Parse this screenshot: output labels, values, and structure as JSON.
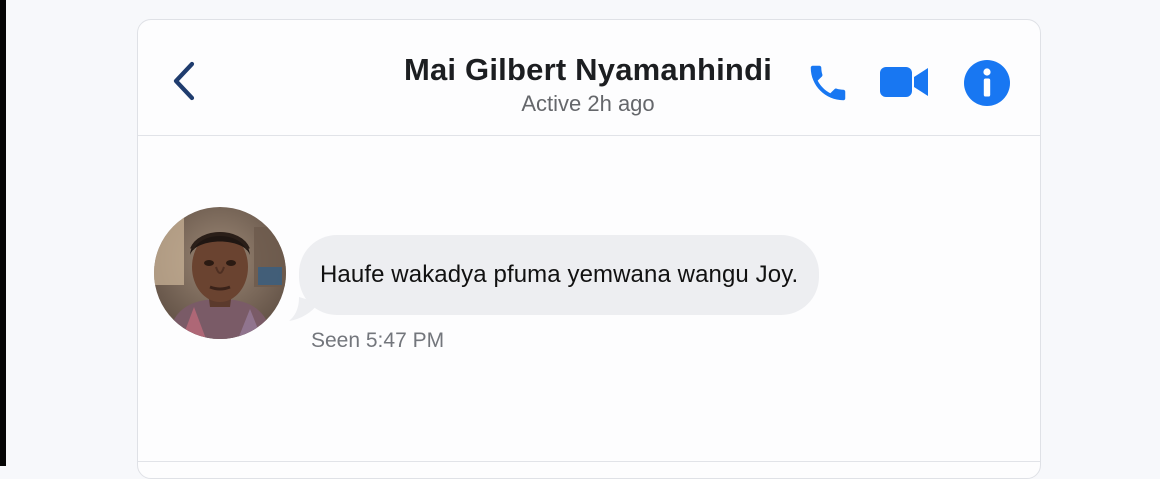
{
  "header": {
    "back_icon": "chevron-left-icon",
    "contact_name": "Mai Gilbert Nyamanhindi",
    "status": "Active 2h ago",
    "call_icon": "phone-icon",
    "video_icon": "video-camera-icon",
    "info_icon": "info-icon"
  },
  "message": {
    "avatar_icon": "contact-avatar",
    "text": "Haufe wakadya pfuma yemwana wangu Joy.",
    "seen": "Seen 5:47 PM"
  },
  "colors": {
    "accent": "#1877f2",
    "back_chevron": "#1f3c6e",
    "bubble": "#edeef1",
    "name_text": "#1c1e21",
    "muted_text": "#65676b"
  }
}
